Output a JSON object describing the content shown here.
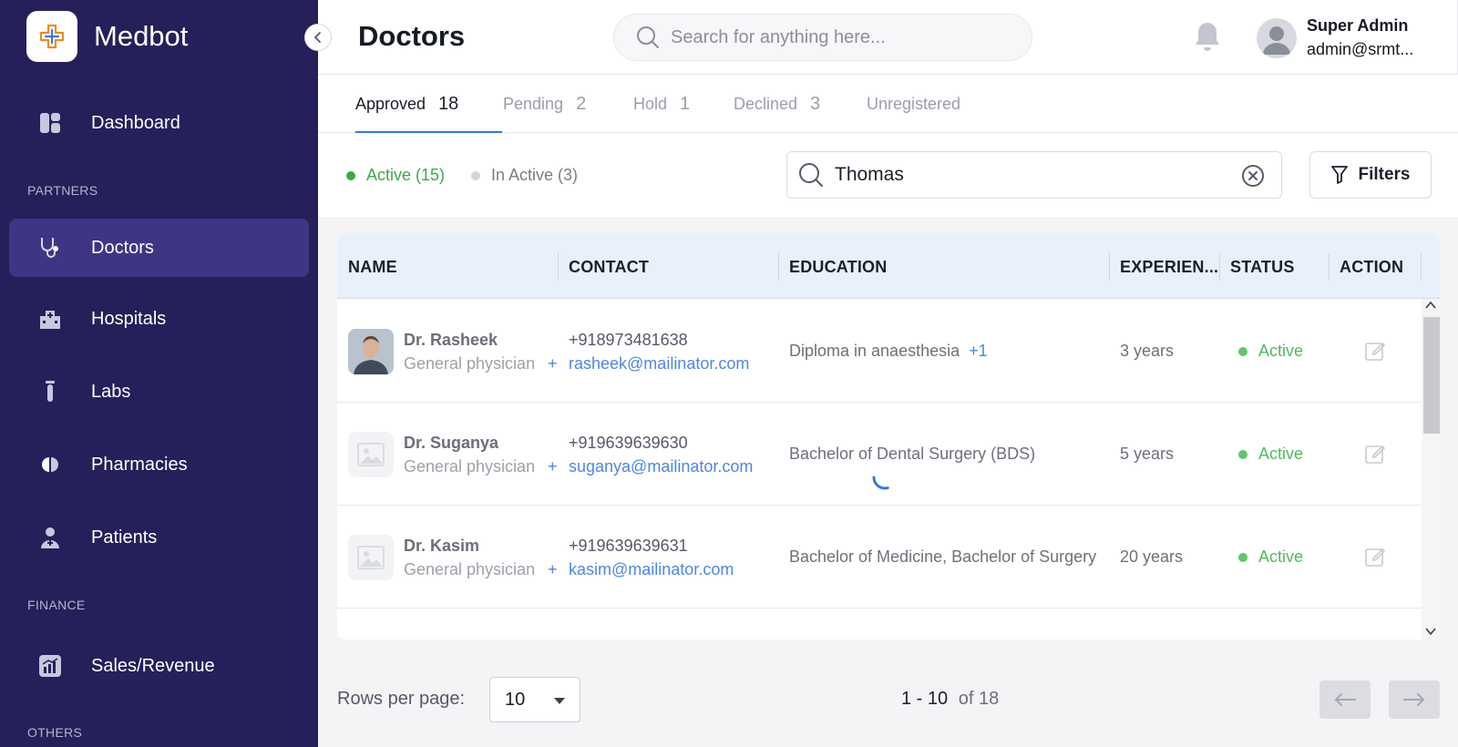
{
  "app": {
    "name": "Medbot"
  },
  "sidebar": {
    "items": [
      {
        "label": "Dashboard"
      },
      {
        "label": "Doctors"
      },
      {
        "label": "Hospitals"
      },
      {
        "label": "Labs"
      },
      {
        "label": "Pharmacies"
      },
      {
        "label": "Patients"
      },
      {
        "label": "Sales/Revenue"
      }
    ],
    "sections": {
      "partners": "PARTNERS",
      "finance": "FINANCE",
      "others": "OTHERS"
    },
    "active_item": "Doctors"
  },
  "header": {
    "title": "Doctors",
    "search_placeholder": "Search for anything here...",
    "user": {
      "name": "Super Admin",
      "email": "admin@srmt..."
    }
  },
  "tabs": [
    {
      "label": "Approved",
      "count": "18",
      "active": true
    },
    {
      "label": "Pending",
      "count": "2"
    },
    {
      "label": "Hold",
      "count": "1"
    },
    {
      "label": "Declined",
      "count": "3"
    },
    {
      "label": "Unregistered",
      "count": ""
    }
  ],
  "status_filters": {
    "active": "Active (15)",
    "inactive": "In Active (3)"
  },
  "search": {
    "value": "Thomas"
  },
  "filters_label": "Filters",
  "table": {
    "columns": [
      "NAME",
      "CONTACT",
      "EDUCATION",
      "EXPERIEN...",
      "STATUS",
      "ACTION"
    ],
    "rows": [
      {
        "name": "Dr. Rasheek",
        "specialty": "General physician",
        "more": "+",
        "phone": "+918973481638",
        "email": "rasheek@mailinator.com",
        "education": "Diploma in anaesthesia",
        "education_more": "+1",
        "experience": "3 years",
        "status": "Active"
      },
      {
        "name": "Dr. Suganya",
        "specialty": "General physician",
        "more": "+",
        "phone": "+919639639630",
        "email": "suganya@mailinator.com",
        "education": "Bachelor of Dental Surgery (BDS)",
        "education_more": "",
        "experience": "5 years",
        "status": "Active"
      },
      {
        "name": "Dr. Kasim",
        "specialty": "General physician",
        "more": "+",
        "phone": "+919639639631",
        "email": "kasim@mailinator.com",
        "education": "Bachelor of Medicine, Bachelor of Surgery",
        "education_more": "",
        "experience": "20 years",
        "status": "Active"
      }
    ]
  },
  "pagination": {
    "rows_label": "Rows per page:",
    "rows_value": "10",
    "range": "1 - 10",
    "of": "of 18"
  },
  "colors": {
    "sidebar_bg": "#25205a",
    "sidebar_active": "#3c3685",
    "accent": "#2f7be0",
    "active_green": "#4cbb5e",
    "link_blue": "#4d86e8",
    "table_header": "#e8f0fc"
  }
}
